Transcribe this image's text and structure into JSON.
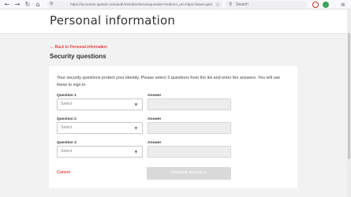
{
  "browser": {
    "back_icon": "←",
    "forward_icon": "→",
    "reload_icon": "↻",
    "home_icon": "⌂",
    "lock_icon": "⛨",
    "url": "https://accounts.qantas.com/auth/member/securequestion?redirect_uri=https://www.qantas.com",
    "star_icon": "☆",
    "search_icon": "⚲",
    "search_placeholder": "Search",
    "menu_icon": "≡"
  },
  "page": {
    "title": "Personal information",
    "back_link": "← Back to Personal information",
    "section_title": "Security questions",
    "intro": "Your security questions protect your identity. Please select 3 questions from the list and enter the answers. You will use these to sign in."
  },
  "questions": [
    {
      "question_label": "Question 1",
      "select_value": "Select",
      "answer_label": "Answer",
      "answer_value": ""
    },
    {
      "question_label": "Question 2",
      "select_value": "Select",
      "answer_label": "Answer",
      "answer_value": ""
    },
    {
      "question_label": "Question 3",
      "select_value": "Select",
      "answer_label": "Answer",
      "answer_value": ""
    }
  ],
  "actions": {
    "cancel_label": "Cancel",
    "update_label": "UPDATE DETAILS",
    "dropdown_icon": "▼"
  },
  "colors": {
    "accent_red": "#e40000",
    "disabled_button": "#d9d9d9",
    "page_background": "#f2f2f2"
  }
}
